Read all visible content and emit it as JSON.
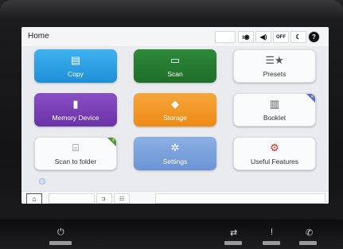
{
  "screen": {
    "title": "Home",
    "status_icons": [
      {
        "name": "network-icon",
        "glyph": "ı◉"
      },
      {
        "name": "volume-icon",
        "glyph": "◀)"
      },
      {
        "name": "wifi-off-icon",
        "glyph": "OFF"
      },
      {
        "name": "sleep-moon-icon",
        "glyph": "☾"
      },
      {
        "name": "help-icon",
        "glyph": "?"
      }
    ]
  },
  "tiles": {
    "copy": {
      "label": "Copy",
      "icon": "▤"
    },
    "scan": {
      "label": "Scan",
      "icon": "▭"
    },
    "presets": {
      "label": "Presets",
      "icon": "☰★"
    },
    "memory_device": {
      "label": "Memory Device",
      "icon": "▮"
    },
    "storage": {
      "label": "Storage",
      "icon": "◆"
    },
    "booklet": {
      "label": "Booklet",
      "icon": "▥"
    },
    "scan_to_folder": {
      "label": "Scan to folder",
      "icon": "⌸"
    },
    "settings": {
      "label": "Settings",
      "icon": "✲"
    },
    "useful_features": {
      "label": "Useful Features",
      "icon": "⚙"
    }
  },
  "bottombar": {
    "home_icon": "⌂",
    "job_icon": "⊐·",
    "queue_icon": "☷"
  },
  "hardware": {
    "power_icon": "⏻",
    "data_icon": "⇄",
    "error_icon": "!",
    "fax_icon": "✆"
  },
  "colors": {
    "copy": "#1e8fd6",
    "scan": "#1f6d2a",
    "memory": "#6a32a8",
    "storage": "#ee8a16",
    "settings": "#6c93d4"
  }
}
